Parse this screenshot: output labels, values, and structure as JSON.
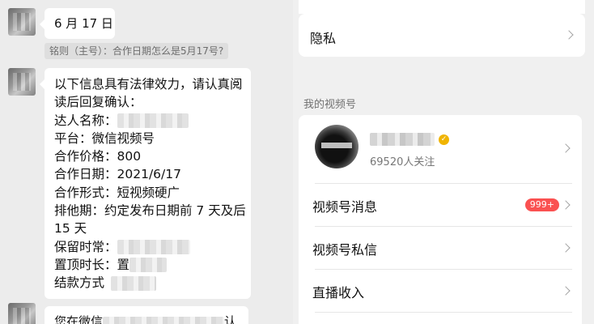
{
  "chat": {
    "date_bubble": "6 月 17 日",
    "quote": "铭则（主号）：合作日期怎么是5月17号?",
    "main_lines": [
      "以下信息具有法律效力，请认真阅",
      "读后回复确认：",
      "达人名称：",
      "平台：微信视频号",
      "合作价格：800",
      "合作日期：2021/6/17",
      "合作形式：短视频硬广",
      "排他期：约定发布日期前 7 天及后",
      "15 天",
      "保留时常：",
      "置顶时长：置",
      "结款方式"
    ],
    "bottom_prefix": "您在微信",
    "bottom_suffix": "认"
  },
  "settings": {
    "privacy_label": "隐私",
    "section_title": "我的视频号",
    "channel_followers": "69520人关注",
    "verified_icon": "verified-badge-icon",
    "rows": [
      {
        "label": "视频号消息",
        "badge": "999+"
      },
      {
        "label": "视频号私信"
      },
      {
        "label": "直播收入"
      }
    ],
    "badge_color": "#fa5151"
  }
}
